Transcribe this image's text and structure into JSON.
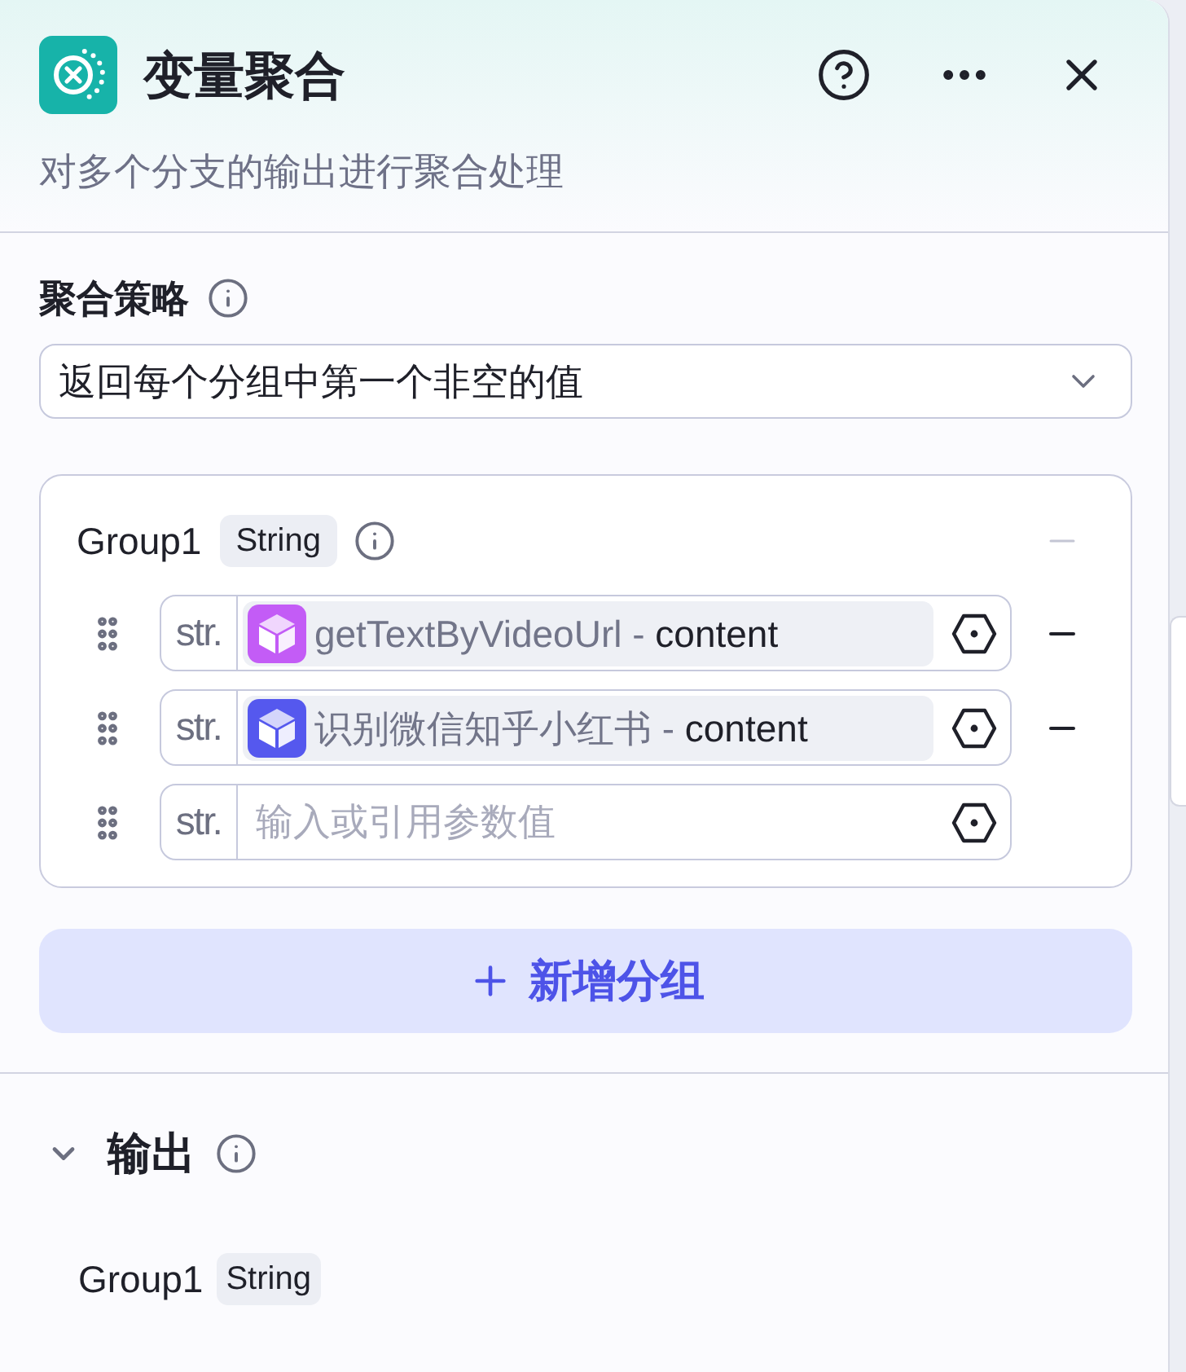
{
  "header": {
    "title": "变量聚合",
    "description": "对多个分支的输出进行聚合处理"
  },
  "strategy": {
    "label": "聚合策略",
    "value": "返回每个分组中第一个非空的值"
  },
  "groups": [
    {
      "name": "Group1",
      "type": "String",
      "remove_disabled": true,
      "variables": [
        {
          "kind": "reference",
          "prefix": "str.",
          "color": "#c35cf6",
          "source": "getTextByVideoUrl -",
          "field": "content",
          "removable": true
        },
        {
          "kind": "reference",
          "prefix": "str.",
          "color": "#5558ee",
          "source": "识别微信知乎小红书 -",
          "field": "content",
          "removable": true
        },
        {
          "kind": "input",
          "prefix": "str.",
          "placeholder": "输入或引用参数值",
          "removable": false
        }
      ]
    }
  ],
  "add_group_button": {
    "label": "新增分组"
  },
  "output": {
    "title": "输出",
    "expanded": true,
    "items": [
      {
        "name": "Group1",
        "type": "String"
      }
    ]
  }
}
